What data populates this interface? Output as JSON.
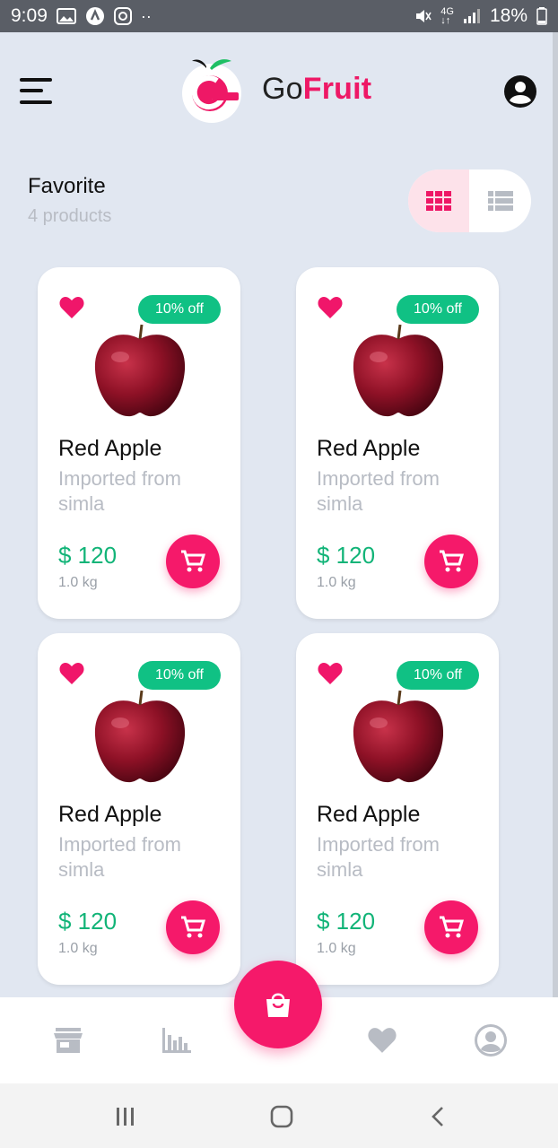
{
  "status_bar": {
    "time": "9:09",
    "battery": "18%",
    "icons": [
      "gallery-icon",
      "nav-icon",
      "instagram-icon",
      "mute-icon",
      "4g-icon",
      "signal-icon",
      "battery-icon"
    ]
  },
  "header": {
    "brand_part1": "Go",
    "brand_part2": "Fruit",
    "colors": {
      "accent": "#ee1866",
      "green": "#10c184",
      "background": "#e1e7f1"
    }
  },
  "section": {
    "title": "Favorite",
    "count": "4 products"
  },
  "products": [
    {
      "name": "Red Apple",
      "description": "Imported from simla",
      "price": "$ 120",
      "weight": "1.0 kg",
      "discount": "10% off"
    },
    {
      "name": "Red Apple",
      "description": "Imported from simla",
      "price": "$ 120",
      "weight": "1.0 kg",
      "discount": "10% off"
    },
    {
      "name": "Red Apple",
      "description": "Imported from simla",
      "price": "$ 120",
      "weight": "1.0 kg",
      "discount": "10% off"
    },
    {
      "name": "Red Apple",
      "description": "Imported from simla",
      "price": "$ 120",
      "weight": "1.0 kg",
      "discount": "10% off"
    }
  ],
  "bottom_nav": {
    "items": [
      "store-icon",
      "chart-icon",
      "shopping-bag-icon",
      "heart-icon",
      "profile-icon"
    ]
  }
}
